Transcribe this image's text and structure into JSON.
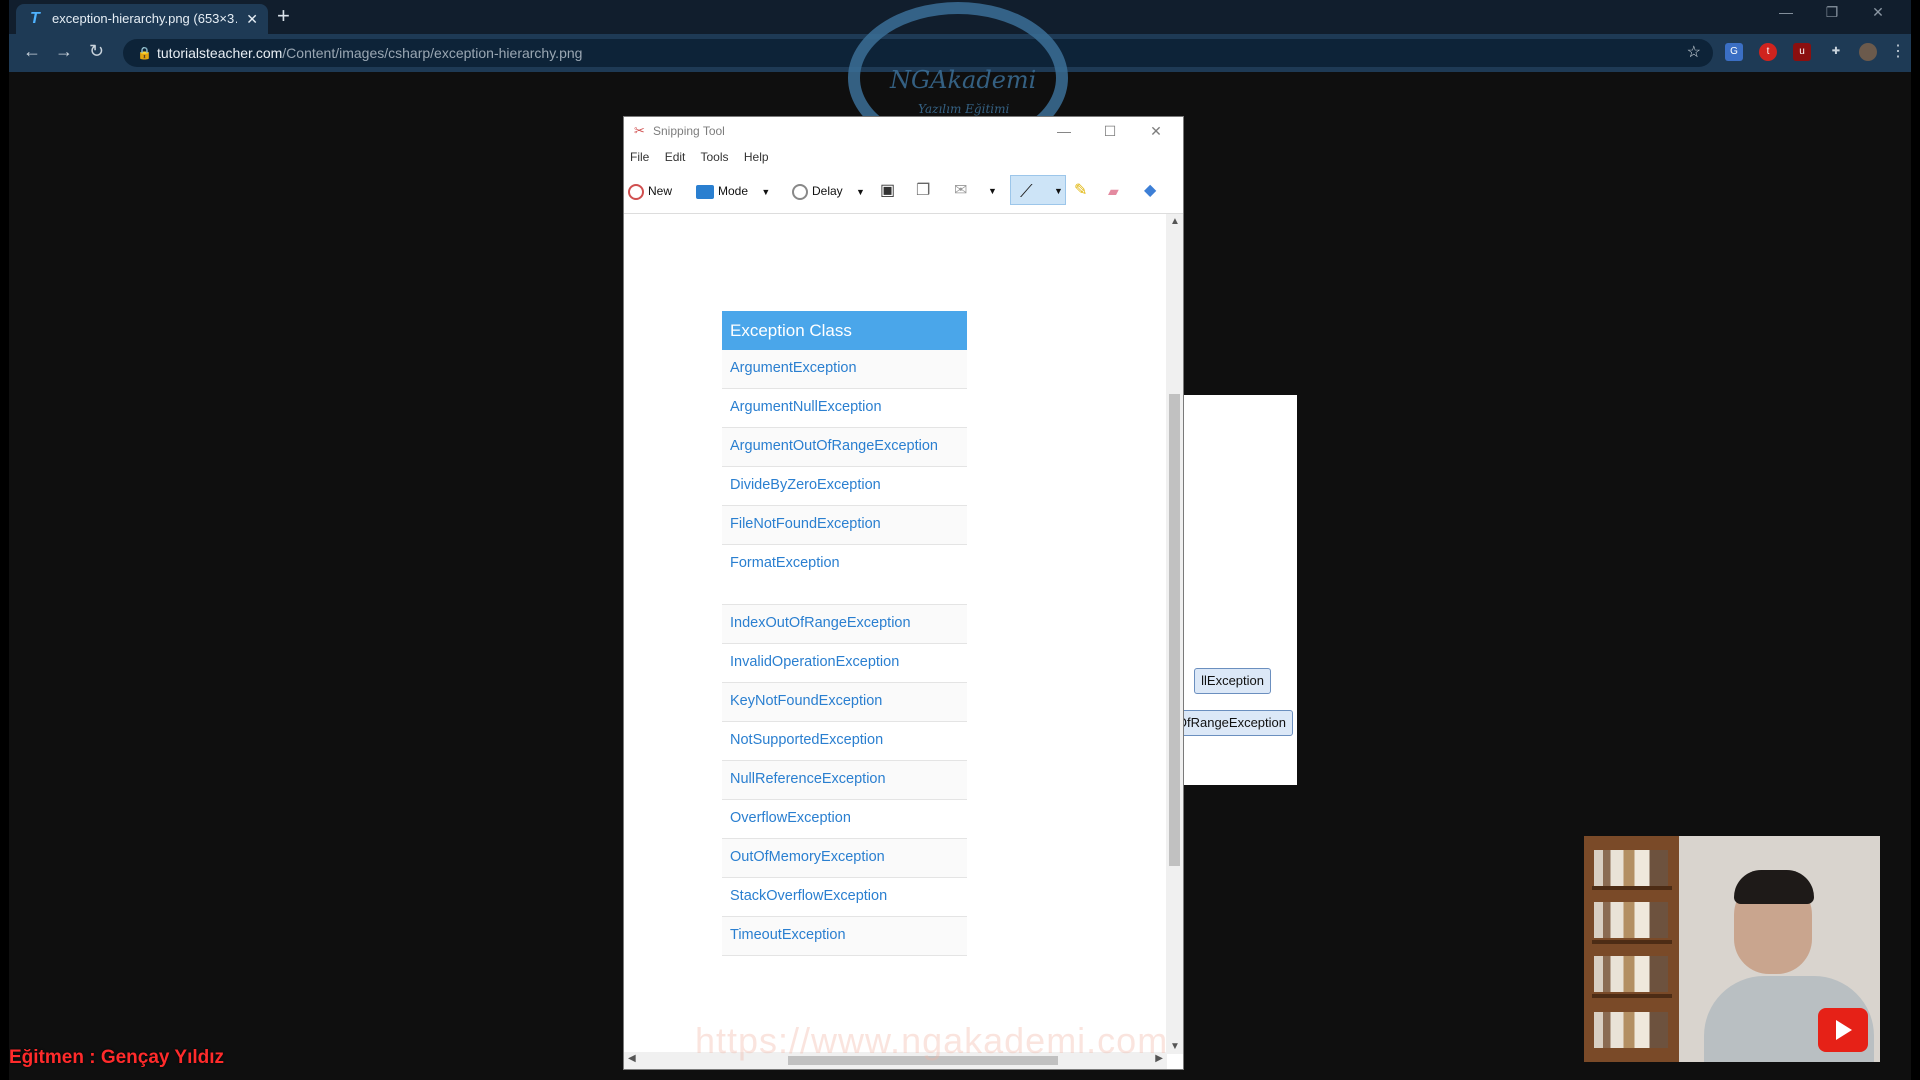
{
  "browser": {
    "tab_title": "exception-hierarchy.png (653×3…",
    "new_tab_symbol": "+",
    "url_domain": "tutorialsteacher.com",
    "url_path": "/Content/images/csharp/exception-hierarchy.png"
  },
  "logo": {
    "line1": "NGAkademi",
    "line2": "Yazılım Eğitimi"
  },
  "snipping_tool": {
    "title": "Snipping Tool",
    "menu": [
      "File",
      "Edit",
      "Tools",
      "Help"
    ],
    "toolbar": {
      "new_label": "New",
      "mode_label": "Mode",
      "delay_label": "Delay"
    }
  },
  "exception_table": {
    "header": "Exception Class",
    "rows": [
      "ArgumentException",
      "ArgumentNullException",
      "ArgumentOutOfRangeException",
      "DivideByZeroException",
      "FileNotFoundException",
      "FormatException",
      "IndexOutOfRangeException",
      "InvalidOperationException",
      "KeyNotFoundException",
      "NotSupportedException",
      "NullReferenceException",
      "OverflowException",
      "OutOfMemoryException",
      "StackOverflowException",
      "TimeoutException"
    ]
  },
  "background_image": {
    "pill1": "llException",
    "pill2": "OfRangeException"
  },
  "watermark_url": "https://www.ngakademi.com",
  "trainer_caption": "Eğitmen : Gençay Yıldız",
  "colors": {
    "accent_blue": "#4aa6ea",
    "link_blue": "#2a7fd0",
    "caption_red": "#ff2b2b"
  }
}
